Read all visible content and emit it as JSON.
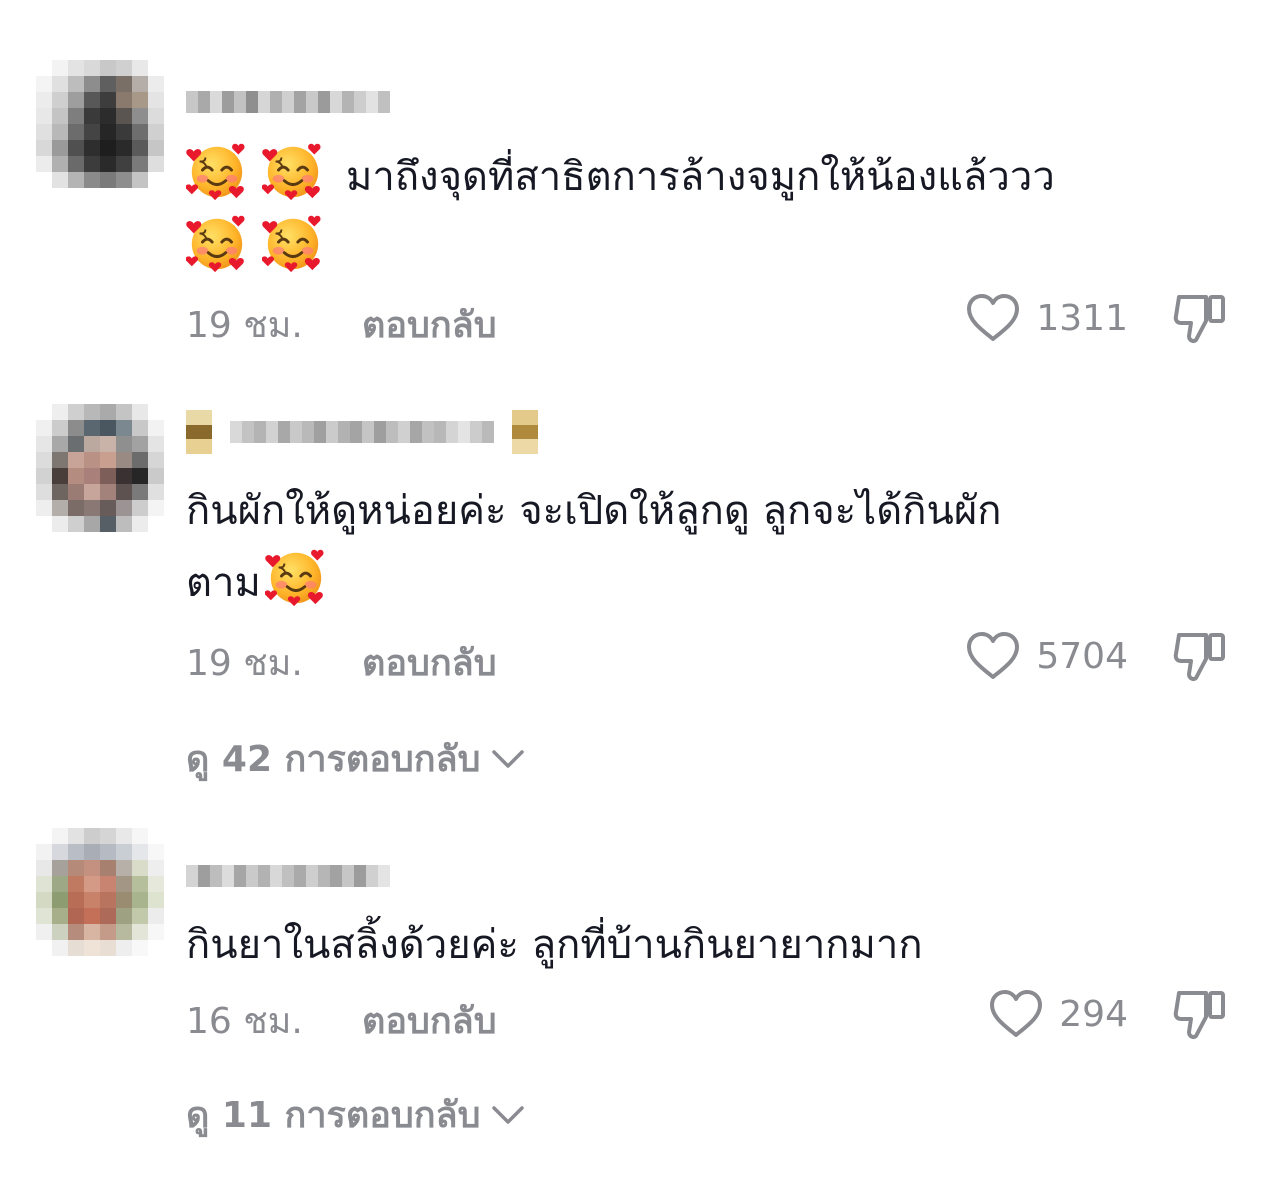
{
  "comments": [
    {
      "text": "มาถึงจุดที่สาธิตการล้างจมูกให้น้องแล้ววว",
      "emoji_icon": "smiling-face-with-hearts-icon",
      "time": "19 ชม.",
      "reply_label": "ตอบกลับ",
      "likes": "1311"
    },
    {
      "text_line1": "กินผักให้ดูหน่อยค่ะ จะเปิดให้ลูกดู ลูกจะได้กินผัก",
      "text_line2": "ตาม",
      "emoji_icon": "smiling-face-with-hearts-icon",
      "time": "19 ชม.",
      "reply_label": "ตอบกลับ",
      "likes": "5704",
      "view_replies": "ดู 42 การตอบกลับ"
    },
    {
      "text": "กินยาในสลิ้งด้วยค่ะ ลูกที่บ้านกินยายากมาก",
      "time": "16 ชม.",
      "reply_label": "ตอบกลับ",
      "likes": "294",
      "view_replies": "ดู 11 การตอบกลับ"
    }
  ],
  "icons": {
    "like": "heart-outline-icon",
    "dislike": "thumbs-down-icon",
    "expand": "chevron-down-icon",
    "emoji": "smiling-face-with-hearts-icon"
  },
  "colors": {
    "text": "#161823",
    "muted": "#8a8b91",
    "emoji_face": "#ffb52a",
    "emoji_heart": "#e8192c"
  }
}
